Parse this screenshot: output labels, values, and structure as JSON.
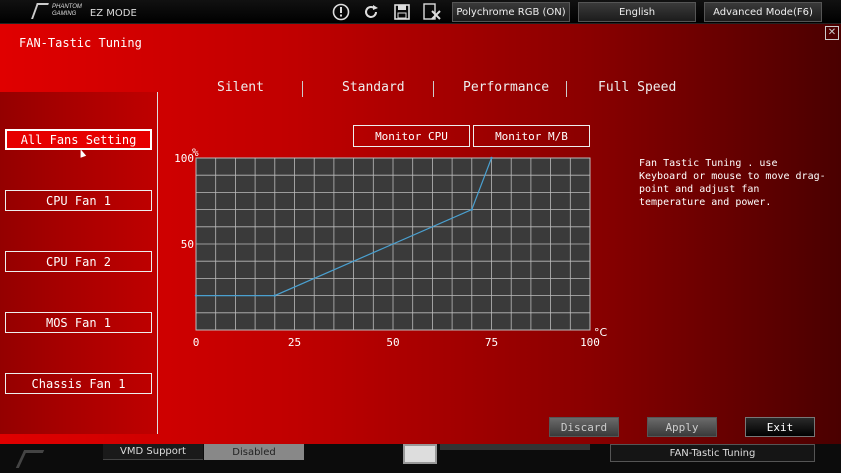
{
  "topbar": {
    "brand_line1": "PHANTOM",
    "brand_line2": "GAMING",
    "mode": "EZ MODE",
    "icons": [
      "info-icon",
      "refresh-icon",
      "save-icon",
      "discard-icon"
    ],
    "polychrome": "Polychrome RGB (ON)",
    "language": "English",
    "advanced": "Advanced Mode(F6)"
  },
  "panel": {
    "title": "FAN-Tastic Tuning",
    "close": "✕"
  },
  "sidebar": {
    "items": [
      {
        "label": "All Fans Setting",
        "active": true
      },
      {
        "label": "CPU Fan 1",
        "active": false
      },
      {
        "label": "CPU Fan 2",
        "active": false
      },
      {
        "label": "MOS Fan 1",
        "active": false
      },
      {
        "label": "Chassis Fan 1",
        "active": false
      }
    ]
  },
  "modes": [
    "Silent",
    "Standard",
    "Performance",
    "Full Speed"
  ],
  "monitor": {
    "cpu": "Monitor CPU",
    "mb": "Monitor M/B"
  },
  "chart_data": {
    "type": "line",
    "xlabel": "°C",
    "ylabel": "%",
    "xlim": [
      0,
      100
    ],
    "ylim": [
      0,
      100
    ],
    "x_ticks": [
      "0",
      "25",
      "50",
      "75",
      "100"
    ],
    "y_ticks": [
      "50",
      "100"
    ],
    "grid": true,
    "series": [
      {
        "x": [
          0,
          20,
          70,
          75
        ],
        "y": [
          20,
          20,
          70,
          100
        ]
      }
    ],
    "colors": {
      "line": "#4aa0d0",
      "grid": "#bbbbbb",
      "bg": "#3a3a3a"
    }
  },
  "description": "Fan Tastic Tuning . use Keyboard or mouse to move drag-point and adjust fan temperature and power.",
  "actions": {
    "discard": "Discard",
    "apply": "Apply",
    "exit": "Exit"
  },
  "bottom": {
    "vmd": "VMD Support",
    "disabled": "Disabled",
    "fan_tuning": "FAN-Tastic Tuning"
  }
}
